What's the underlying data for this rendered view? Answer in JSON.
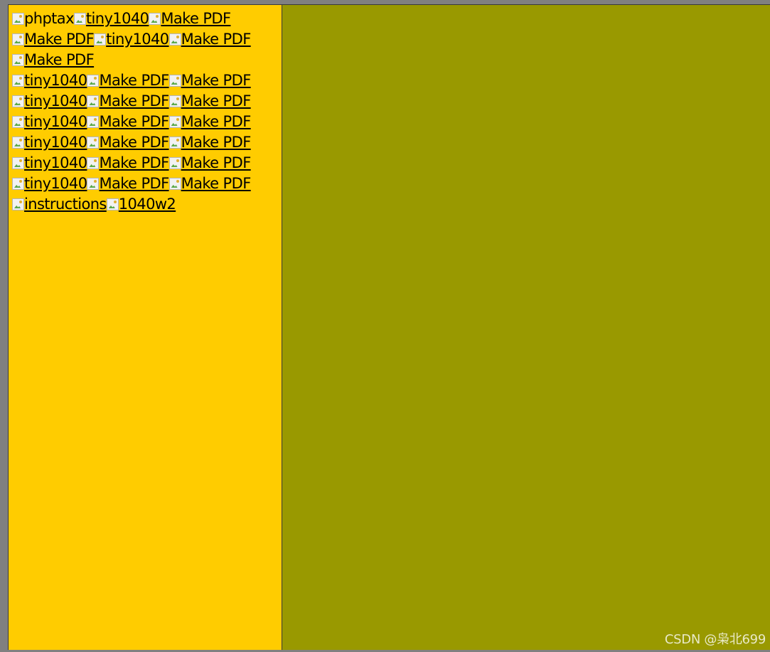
{
  "colors": {
    "left_frame_bg": "#ffcc00",
    "right_frame_bg": "#999900",
    "outer_bg": "#808080"
  },
  "left_frame": {
    "rows": [
      [
        {
          "alt": "phptax",
          "link": false
        },
        {
          "alt": "tiny1040",
          "link": true
        },
        {
          "alt": "Make PDF",
          "link": true
        }
      ],
      [
        {
          "alt": "Make PDF",
          "link": true
        },
        {
          "alt": "tiny1040",
          "link": true
        },
        {
          "alt": "Make PDF",
          "link": true
        }
      ],
      [
        {
          "alt": "Make PDF",
          "link": true
        }
      ],
      [
        {
          "alt": "tiny1040",
          "link": true
        },
        {
          "alt": "Make PDF",
          "link": true
        },
        {
          "alt": "Make PDF",
          "link": true
        }
      ],
      [
        {
          "alt": "tiny1040",
          "link": true
        },
        {
          "alt": "Make PDF",
          "link": true
        },
        {
          "alt": "Make PDF",
          "link": true
        }
      ],
      [
        {
          "alt": "tiny1040",
          "link": true
        },
        {
          "alt": "Make PDF",
          "link": true
        },
        {
          "alt": "Make PDF",
          "link": true
        }
      ],
      [
        {
          "alt": "tiny1040",
          "link": true
        },
        {
          "alt": "Make PDF",
          "link": true
        },
        {
          "alt": "Make PDF",
          "link": true
        }
      ],
      [
        {
          "alt": "tiny1040",
          "link": true
        },
        {
          "alt": "Make PDF",
          "link": true
        },
        {
          "alt": "Make PDF",
          "link": true
        }
      ],
      [
        {
          "alt": "tiny1040",
          "link": true
        },
        {
          "alt": "Make PDF",
          "link": true
        },
        {
          "alt": "Make PDF",
          "link": true
        }
      ],
      [
        {
          "alt": "instructions",
          "link": true
        },
        {
          "alt": "1040w2",
          "link": true
        }
      ]
    ]
  },
  "watermark": "CSDN @枭北699"
}
